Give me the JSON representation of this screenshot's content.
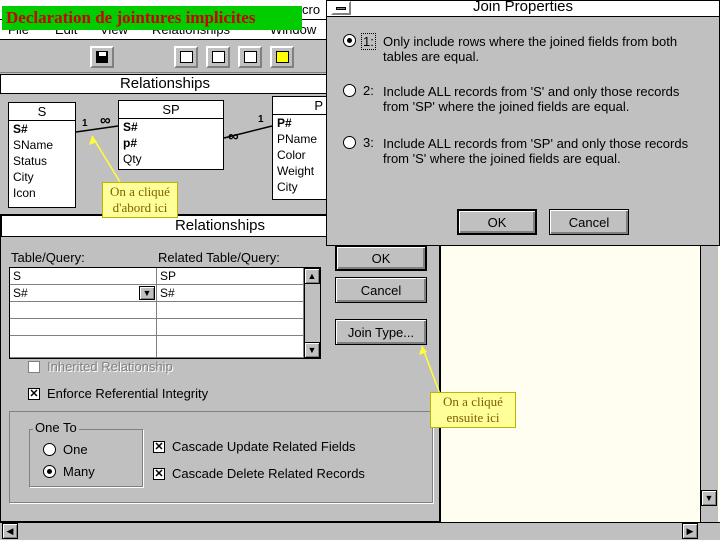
{
  "slide_title": "Declaration de jointures implicites",
  "app": {
    "title_fragment": "cro",
    "menu": [
      "File",
      "Edit",
      "View",
      "Relationships",
      "Window"
    ],
    "pane_title": "Relationships"
  },
  "tables": {
    "s": {
      "name": "S",
      "fields": [
        "S#",
        "SName",
        "Status",
        "City",
        "Icon"
      ]
    },
    "sp": {
      "name": "SP",
      "fields": [
        "S#",
        "p#",
        "Qty"
      ]
    },
    "p": {
      "name": "P",
      "fields": [
        "P#",
        "PName",
        "Color",
        "Weight",
        "City"
      ]
    }
  },
  "links": {
    "s_sp_one": "1",
    "s_sp_many": "∞",
    "p_sp_one": "1",
    "p_sp_many": "∞"
  },
  "annotations": {
    "first": "On a cliqué d'abord ici",
    "second": "On a cliqué ensuite ici"
  },
  "rel_dialog": {
    "title": "Relationships",
    "table_query_label": "Table/Query:",
    "related_label": "Related Table/Query:",
    "table_value": "S",
    "related_value": "SP",
    "rows": [
      {
        "left": "S#",
        "right": "S#"
      }
    ],
    "ok": "OK",
    "cancel": "Cancel",
    "join_type": "Join Type...",
    "inherited": "Inherited Relationship",
    "enforce": "Enforce Referential Integrity",
    "one_to": "One To",
    "one": "One",
    "many": "Many",
    "cascade_update": "Cascade Update Related Fields",
    "cascade_delete": "Cascade Delete Related Records"
  },
  "join_dialog": {
    "title": "Join Properties",
    "options": [
      {
        "num": "1:",
        "line1": "Only include rows where the joined fields from both",
        "line2": "tables are equal."
      },
      {
        "num": "2:",
        "line1": "Include ALL records from 'S' and only those records",
        "line2": "from 'SP' where the joined fields are equal."
      },
      {
        "num": "3:",
        "line1": "Include ALL records from 'SP' and only those records",
        "line2": "from 'S' where the joined fields are equal."
      }
    ],
    "ok": "OK",
    "cancel": "Cancel"
  },
  "colors": {
    "face": "#c0c0c0",
    "workspace": "#fffef0",
    "annotation": "#ffff99",
    "title_green": "#00cc00",
    "title_text": "#cc0000"
  }
}
